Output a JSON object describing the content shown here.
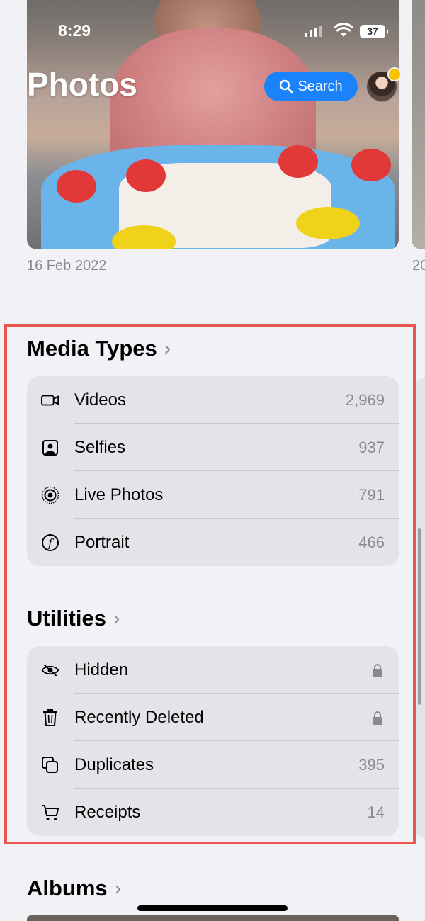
{
  "status_bar": {
    "time": "8:29",
    "battery": "37"
  },
  "header": {
    "title": "Photos",
    "search_label": "Search"
  },
  "hero": {
    "date": "16 Feb 2022",
    "next_date_peek": "20"
  },
  "media_types": {
    "title": "Media Types",
    "chevron": "›",
    "items": [
      {
        "icon": "video-camera-icon",
        "label": "Videos",
        "count": "2,969"
      },
      {
        "icon": "selfie-icon",
        "label": "Selfies",
        "count": "937"
      },
      {
        "icon": "live-photo-icon",
        "label": "Live Photos",
        "count": "791"
      },
      {
        "icon": "portrait-icon",
        "label": "Portrait",
        "count": "466"
      }
    ]
  },
  "utilities": {
    "title": "Utilities",
    "chevron": "›",
    "items": [
      {
        "icon": "eye-slash-icon",
        "label": "Hidden",
        "locked": true
      },
      {
        "icon": "trash-icon",
        "label": "Recently Deleted",
        "locked": true
      },
      {
        "icon": "duplicate-icon",
        "label": "Duplicates",
        "count": "395"
      },
      {
        "icon": "cart-icon",
        "label": "Receipts",
        "count": "14"
      }
    ]
  },
  "albums": {
    "title": "Albums",
    "chevron": "›"
  },
  "colors": {
    "accent": "#1a82fb",
    "highlight": "#e8574e",
    "secondary_text": "#8a8a8e"
  }
}
